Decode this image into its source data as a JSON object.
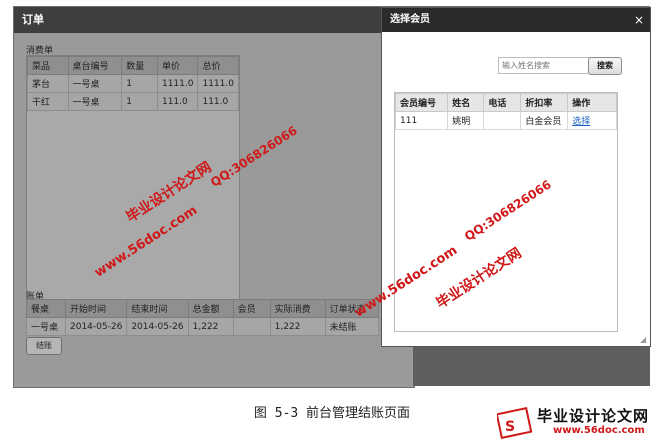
{
  "main_window": {
    "title": "订单",
    "consumption_label": "消费单",
    "consumption_headers": [
      "菜品",
      "桌台编号",
      "数量",
      "单价",
      "总价"
    ],
    "consumption_rows": [
      [
        "茅台",
        "一号桌",
        "1",
        "1111.0",
        "1111.0"
      ],
      [
        "干红",
        "一号桌",
        "1",
        "111.0",
        "111.0"
      ]
    ],
    "bill_label": "账单",
    "bill_headers": [
      "餐桌",
      "开始时间",
      "结束时间",
      "总金额",
      "会员",
      "实际消费",
      "订单状态"
    ],
    "bill_rows": [
      [
        "一号桌",
        "2014-05-26",
        "2014-05-26",
        "1,222",
        "",
        "1,222",
        "未结账"
      ]
    ],
    "checkout_button": "结账"
  },
  "modal": {
    "title": "选择会员",
    "close": "×",
    "search_placeholder": "输入姓名搜索",
    "search_button": "搜索",
    "headers": [
      "会员编号",
      "姓名",
      "电话",
      "折扣率",
      "操作"
    ],
    "rows": [
      {
        "id": "111",
        "name": "姚明",
        "phone": "",
        "discount": "白金会员",
        "action": "选择"
      }
    ]
  },
  "watermarks": {
    "site": "www.56doc.com",
    "qq": "QQ:306826066",
    "brand": "毕业设计论文网"
  },
  "caption": "图 5-3  前台管理结账页面",
  "logo": {
    "text": "毕业设计论文网",
    "url": "www.56doc.com"
  },
  "colors": {
    "watermark": "#d01818",
    "dialog_title_bg": "#2b2b2b",
    "link": "#1b5fbf"
  }
}
